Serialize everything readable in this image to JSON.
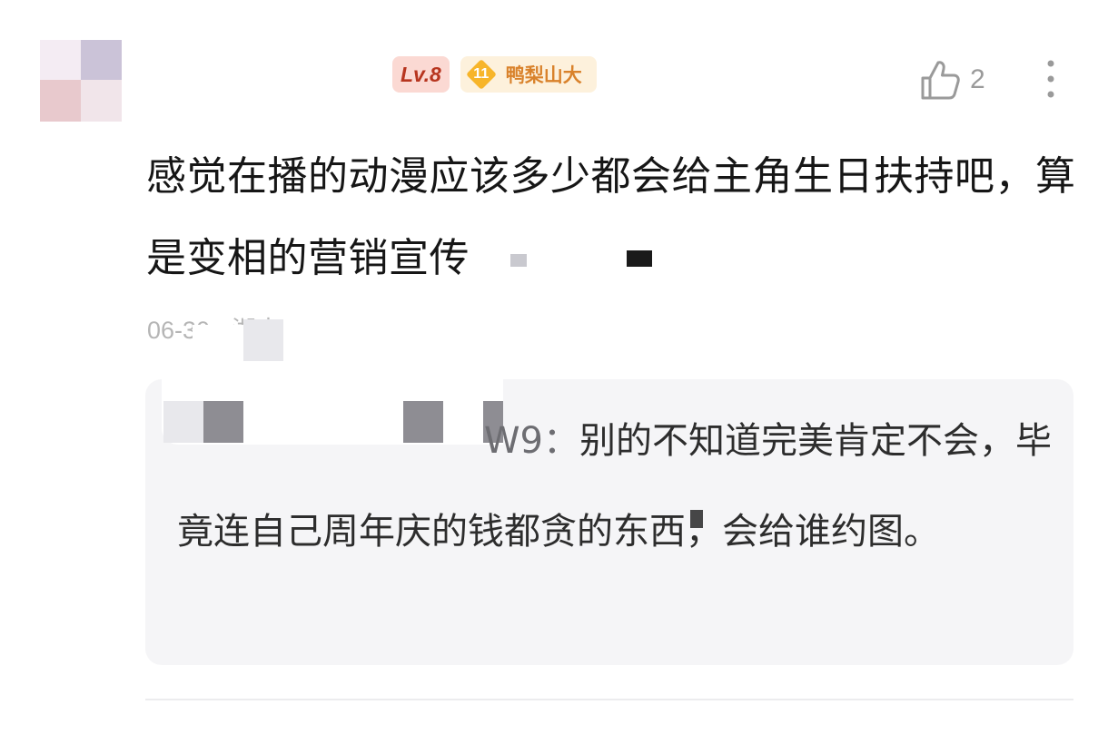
{
  "comment": {
    "user": {
      "level_badge": "Lv.8",
      "fan_level": "11",
      "fan_medal_name": "鸭梨山大"
    },
    "like_count": "2",
    "text": "感觉在播的动漫应该多少都会给主角生日扶持吧，算是变相的营销宣传",
    "meta": "06-30 · 湖南",
    "reply": {
      "author_visible": "W9：",
      "text": "别的不知道完美肯定不会，毕竟连自己周年庆的钱都贪的东西，会给谁约图。"
    }
  },
  "icons": {
    "like": "thumbs-up-icon",
    "more": "more-vertical-icon"
  },
  "colors": {
    "level_badge_bg": "#fbd9d3",
    "level_badge_text": "#b7351f",
    "fan_badge_bg": "#fdf1dc",
    "fan_badge_accent": "#f7b52a",
    "fan_badge_text": "#d9822b",
    "reply_bg": "#f5f5f7",
    "muted_text": "#b5b5b5"
  }
}
